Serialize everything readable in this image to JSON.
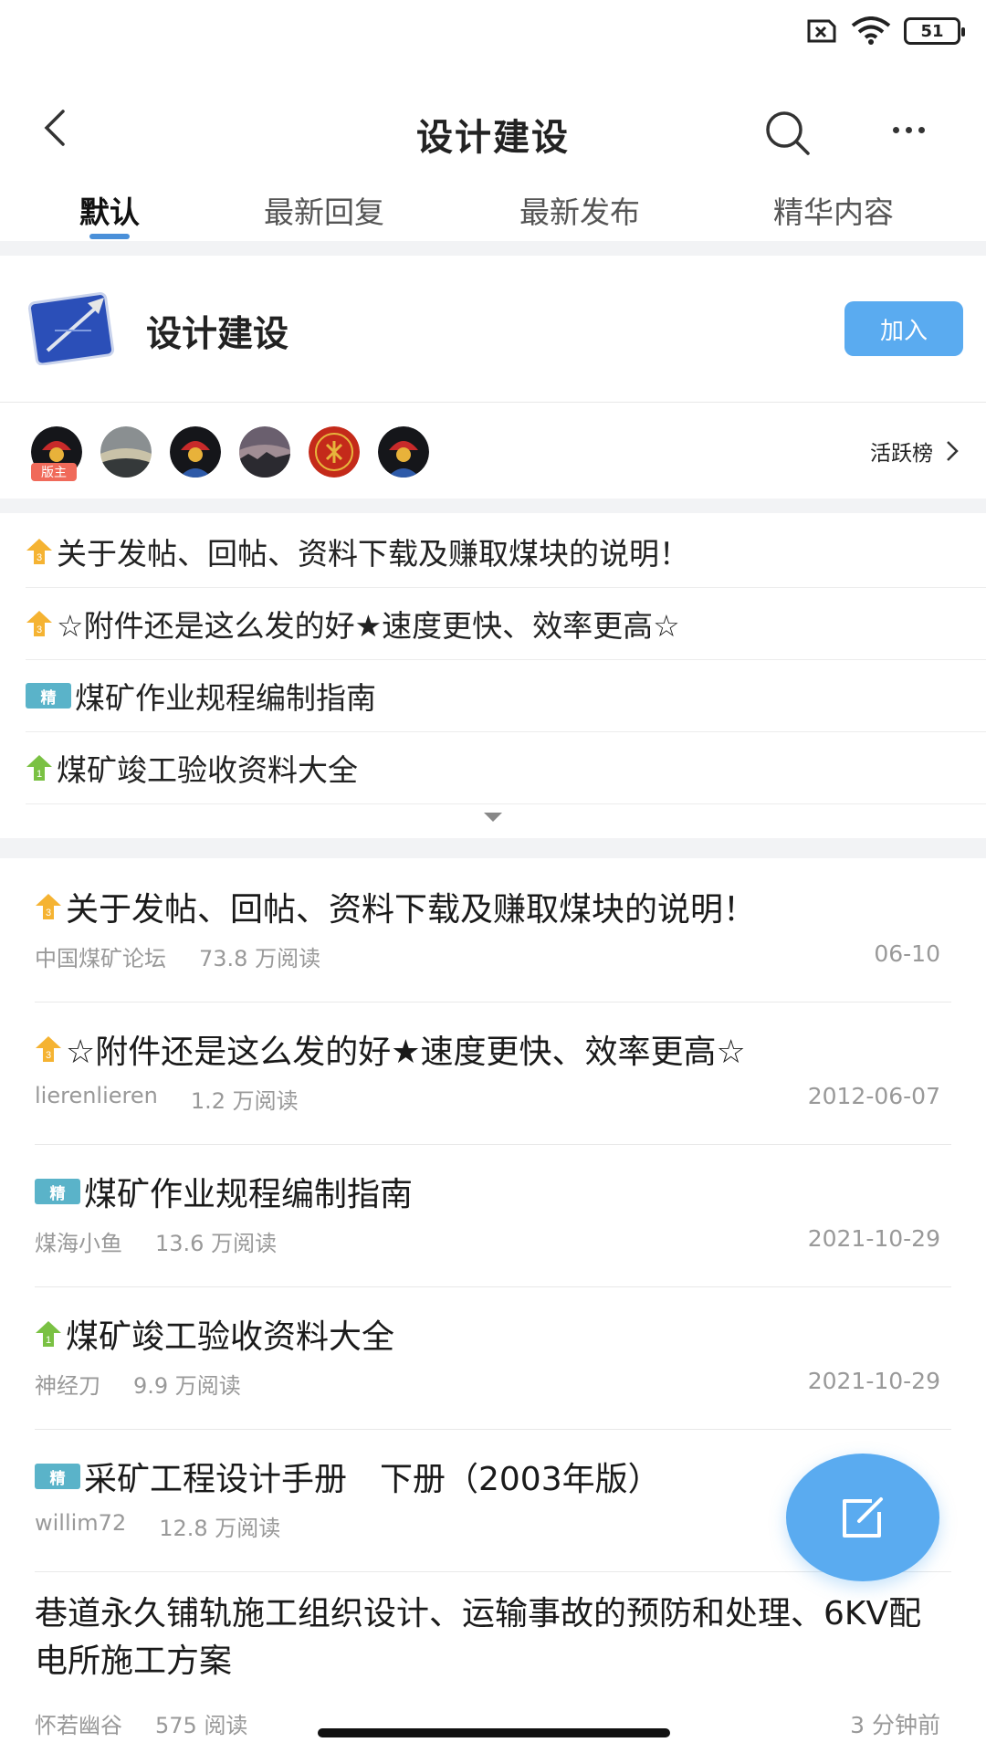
{
  "status_bar": {
    "battery": "51",
    "icons": [
      "sim-missing-icon",
      "wifi-icon",
      "battery-icon"
    ]
  },
  "header": {
    "title": "设计建设",
    "icons": [
      "back-icon",
      "search-icon",
      "more-icon"
    ]
  },
  "tabs": [
    {
      "label": "默认",
      "active": true
    },
    {
      "label": "最新回复",
      "active": false
    },
    {
      "label": "最新发布",
      "active": false
    },
    {
      "label": "精华内容",
      "active": false
    }
  ],
  "forum": {
    "name": "设计建设",
    "join_label": "加入",
    "admin_badge": "版主",
    "rank_label": "活跃榜"
  },
  "pinned": [
    {
      "badge": "up-3",
      "title": "关于发帖、回帖、资料下载及赚取煤块的说明！"
    },
    {
      "badge": "up-3",
      "title": "☆附件还是这么发的好★速度更快、效率更高☆"
    },
    {
      "badge": "jing",
      "title": "煤矿作业规程编制指南"
    },
    {
      "badge": "up-1",
      "title": "煤矿竣工验收资料大全"
    }
  ],
  "posts": [
    {
      "badge": "up-3",
      "title": "关于发帖、回帖、资料下载及赚取煤块的说明！",
      "author": "中国煤矿论坛",
      "reads": "73.8 万阅读",
      "date": "06-10"
    },
    {
      "badge": "up-3",
      "title": "☆附件还是这么发的好★速度更快、效率更高☆",
      "author": "lierenlieren",
      "reads": "1.2 万阅读",
      "date": "2012-06-07"
    },
    {
      "badge": "jing",
      "title": "煤矿作业规程编制指南",
      "author": "煤海小鱼",
      "reads": "13.6 万阅读",
      "date": "2021-10-29"
    },
    {
      "badge": "up-1",
      "title": "煤矿竣工验收资料大全",
      "author": "神经刀",
      "reads": "9.9 万阅读",
      "date": "2021-10-29"
    },
    {
      "badge": "jing",
      "title": "采矿工程设计手册　下册（2003年版）",
      "author": "willim72",
      "reads": "12.8 万阅读",
      "date": ""
    },
    {
      "badge": "",
      "title": "巷道永久铺轨施工组织设计、运输事故的预防和处理、6KV配电所施工方案",
      "author": "怀若幽谷",
      "reads": "575 阅读",
      "date": "3 分钟前"
    }
  ],
  "badges": {
    "jing_text": "精",
    "up3_text": "3",
    "up1_text": "1"
  },
  "colors": {
    "accent": "#5aabf0",
    "jing": "#5ab3c9",
    "up3": "#f5b332",
    "up1": "#7ac143",
    "admin": "#f06a5a"
  },
  "fab": {
    "icon": "compose-icon"
  }
}
